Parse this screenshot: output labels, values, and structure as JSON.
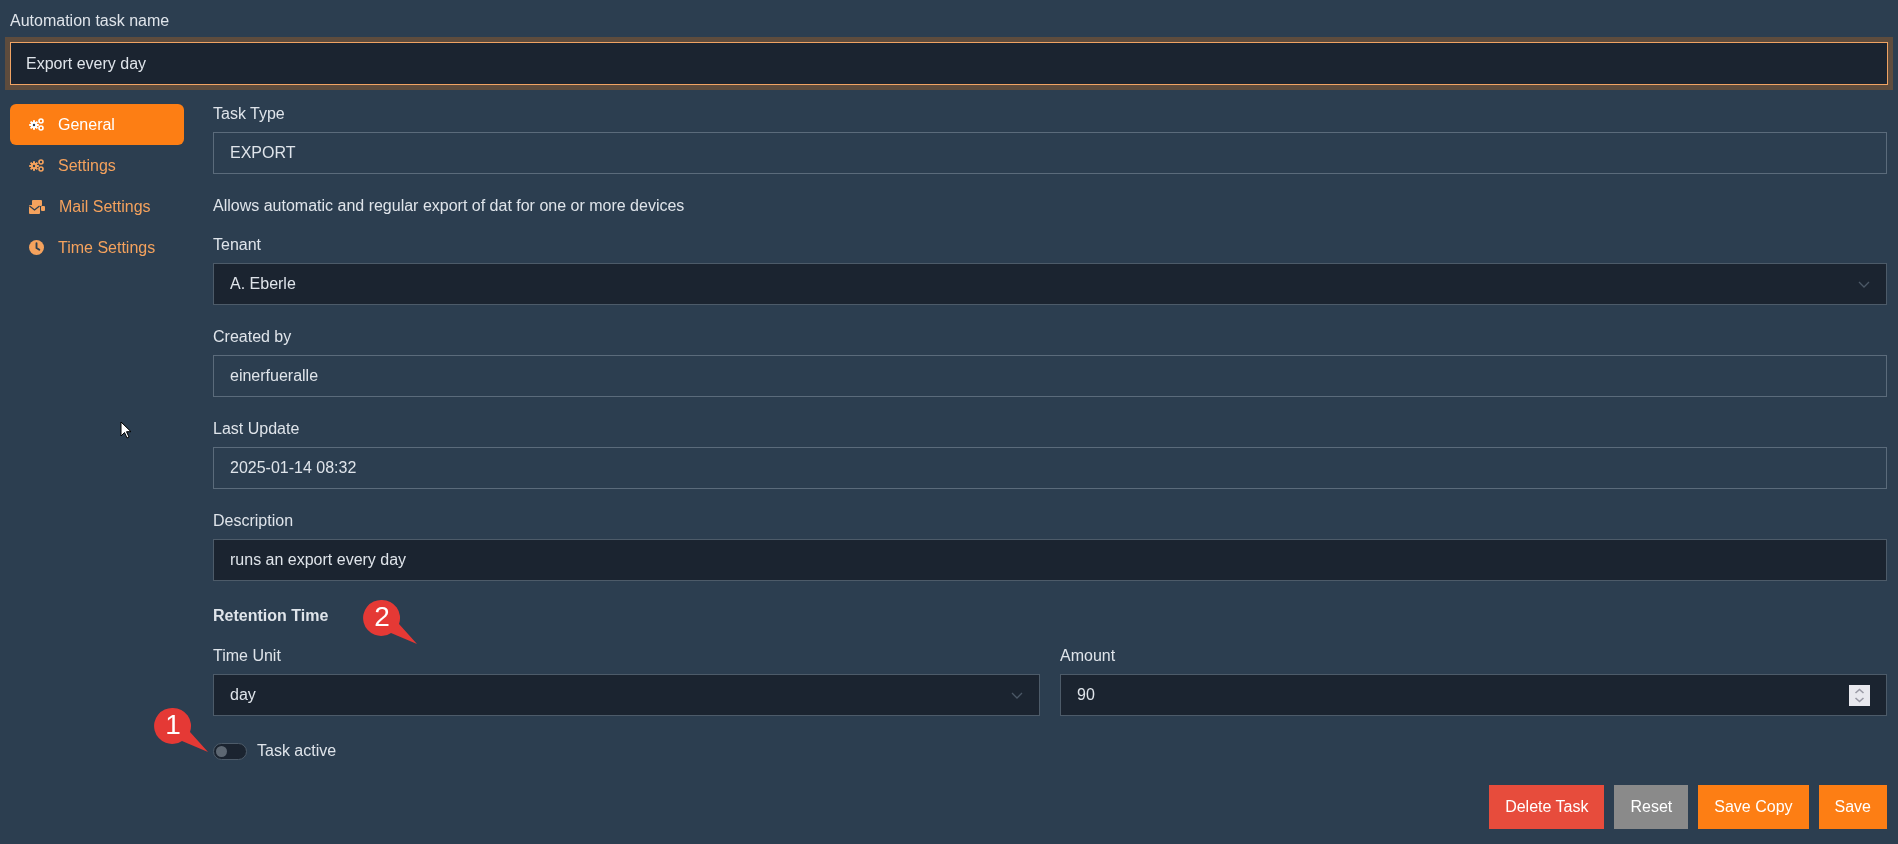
{
  "task_name": {
    "label": "Automation task name",
    "value": "Export every day"
  },
  "sidebar": {
    "items": [
      {
        "label": "General",
        "kind": "gears",
        "selected": true
      },
      {
        "label": "Settings",
        "kind": "gears",
        "selected": false
      },
      {
        "label": "Mail Settings",
        "kind": "mail",
        "selected": false
      },
      {
        "label": "Time Settings",
        "kind": "clock",
        "selected": false
      }
    ]
  },
  "fields": [
    {
      "kind": "readonly",
      "label": "Task Type",
      "value": "EXPORT",
      "note": "Allows automatic and regular export of dat for one or more devices"
    },
    {
      "kind": "select",
      "label": "Tenant",
      "value": "A. Eberle"
    },
    {
      "kind": "readonly",
      "label": "Created by",
      "value": "einerfueralle"
    },
    {
      "kind": "readonly",
      "label": "Last Update",
      "value": "2025-01-14 08:32"
    },
    {
      "kind": "text",
      "label": "Description",
      "value": "runs an export every day"
    }
  ],
  "retention": {
    "title": "Retention Time",
    "fields": [
      {
        "kind": "select",
        "label": "Time Unit",
        "value": "day"
      },
      {
        "kind": "number",
        "label": "Amount",
        "value": "90"
      }
    ]
  },
  "task_active": {
    "label": "Task active",
    "on": false
  },
  "buttons": [
    {
      "label": "Delete Task",
      "kind": "danger"
    },
    {
      "label": "Reset",
      "kind": "neutral"
    },
    {
      "label": "Save Copy",
      "kind": "primary"
    },
    {
      "label": "Save",
      "kind": "primary"
    }
  ],
  "annotations": [
    {
      "label": "1"
    },
    {
      "label": "2"
    }
  ]
}
